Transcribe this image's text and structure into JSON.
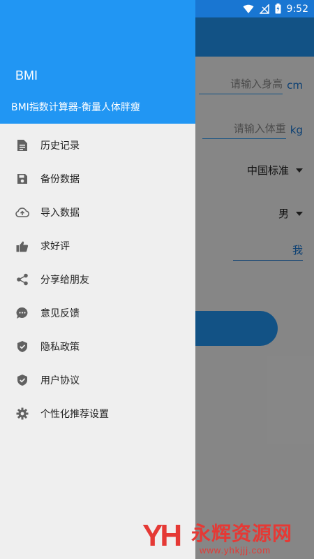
{
  "status_bar": {
    "time": "9:52",
    "icons": [
      "image-icon",
      "wifi-icon",
      "no-signal-icon",
      "battery-charging-icon"
    ]
  },
  "background": {
    "height_placeholder": "请输入身高",
    "height_unit": "cm",
    "weight_placeholder": "请输入体重",
    "weight_unit": "kg",
    "standard_select": "中国标准",
    "gender_select": "男",
    "name_value": "我"
  },
  "drawer": {
    "title": "BMI",
    "subtitle": "BMI指数计算器-衡量人体胖瘦",
    "items": [
      {
        "label": "历史记录",
        "icon": "document-icon"
      },
      {
        "label": "备份数据",
        "icon": "save-icon"
      },
      {
        "label": "导入数据",
        "icon": "cloud-upload-icon"
      },
      {
        "label": "求好评",
        "icon": "thumb-up-icon"
      },
      {
        "label": "分享给朋友",
        "icon": "share-icon"
      },
      {
        "label": "意见反馈",
        "icon": "chat-icon"
      },
      {
        "label": "隐私政策",
        "icon": "shield-check-icon"
      },
      {
        "label": "用户协议",
        "icon": "shield-check-icon"
      },
      {
        "label": "个性化推荐设置",
        "icon": "gear-icon"
      }
    ]
  },
  "watermark": {
    "logo": "YH",
    "title": "永辉资源网",
    "url": "www.yhkjjj.com"
  },
  "colors": {
    "primary": "#2196f3",
    "primary_dark": "#1976d2",
    "drawer_bg": "#efefef",
    "icon_gray": "#616161",
    "watermark_red": "#e53935"
  }
}
